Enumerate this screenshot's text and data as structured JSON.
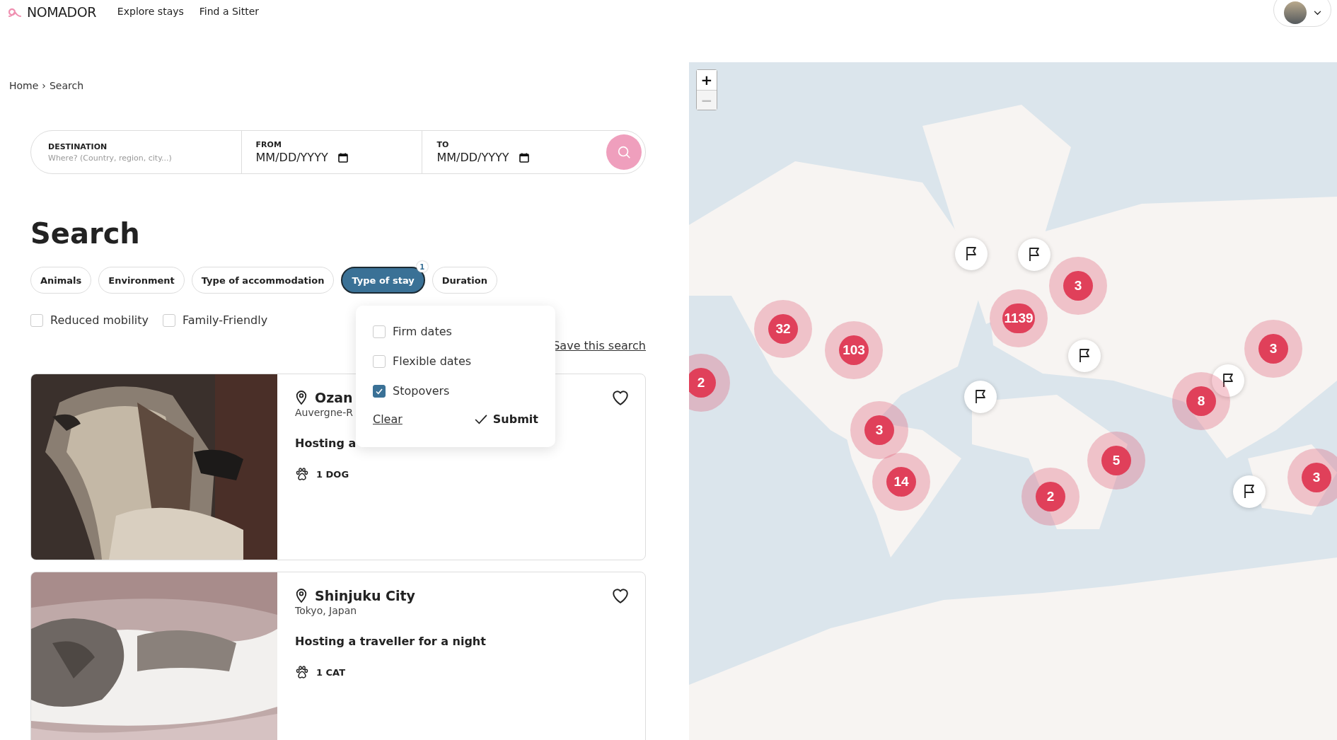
{
  "header": {
    "logo": "NOMADOR",
    "nav": [
      "Explore stays",
      "Find a Sitter"
    ]
  },
  "breadcrumb": {
    "items": [
      "Home",
      "Search"
    ],
    "separator": "›"
  },
  "search_bar": {
    "fields": [
      {
        "label": "DESTINATION",
        "placeholder": "Where? (Country, region, city...)",
        "kind": "text"
      },
      {
        "label": "FROM",
        "value": "MM/DD/YYYY",
        "kind": "date"
      },
      {
        "label": "TO",
        "value": "MM/DD/YYYY",
        "kind": "date"
      }
    ]
  },
  "title": "Search",
  "filters": [
    {
      "label": "Animals",
      "selected": false
    },
    {
      "label": "Environment",
      "selected": false
    },
    {
      "label": "Type of accommodation",
      "selected": false
    },
    {
      "label": "Type of stay",
      "selected": true,
      "badge": "1"
    },
    {
      "label": "Duration",
      "selected": false
    }
  ],
  "toggles": [
    {
      "label": "Reduced mobility",
      "checked": false
    },
    {
      "label": "Family-Friendly",
      "checked": false
    }
  ],
  "dropdown": {
    "options": [
      {
        "label": "Firm dates",
        "checked": false
      },
      {
        "label": "Flexible dates",
        "checked": false
      },
      {
        "label": "Stopovers",
        "checked": true
      }
    ],
    "clear": "Clear",
    "submit": "Submit"
  },
  "save_search": "Save this search",
  "listings": [
    {
      "title": "Ozan",
      "location": "Auvergne-R",
      "description": "Hosting a",
      "animals": "1 DOG",
      "kind": "dog"
    },
    {
      "title": "Shinjuku City",
      "location": "Tokyo, Japan",
      "description": "Hosting a traveller for a night",
      "animals": "1 CAT",
      "kind": "cat"
    }
  ],
  "map": {
    "zoom_in": "+",
    "zoom_out": "−",
    "zoom_out_disabled": true,
    "markers": [
      {
        "kind": "flag"
      },
      {
        "kind": "flag"
      },
      {
        "kind": "cluster",
        "count": "3"
      },
      {
        "kind": "cluster",
        "count": "1139"
      },
      {
        "kind": "cluster",
        "count": "32"
      },
      {
        "kind": "cluster",
        "count": "3"
      },
      {
        "kind": "cluster",
        "count": "103"
      },
      {
        "kind": "flag"
      },
      {
        "kind": "flag"
      },
      {
        "kind": "cluster",
        "count": "2"
      },
      {
        "kind": "flag"
      },
      {
        "kind": "cluster",
        "count": "8"
      },
      {
        "kind": "cluster",
        "count": "3"
      },
      {
        "kind": "cluster",
        "count": "5"
      },
      {
        "kind": "cluster",
        "count": "3"
      },
      {
        "kind": "cluster",
        "count": "14"
      },
      {
        "kind": "flag"
      },
      {
        "kind": "cluster",
        "count": "2"
      }
    ]
  }
}
